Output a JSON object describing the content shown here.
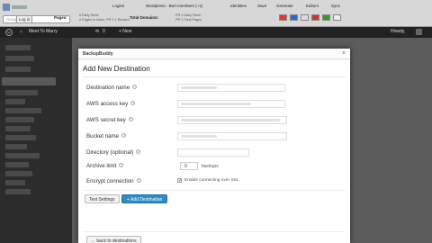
{
  "toolbar": {
    "search_placeholder": "Google",
    "login_label": "Log in",
    "pages_label": "Pages:",
    "pages_detail_1": "# Daily Rank",
    "pages_detail_2": "# Pages in Index",
    "pages_detail_3": "PR 0 1 Ranked",
    "pages_detail_4": "Rank Dom...",
    "domain_label": "Total Domains:",
    "domain_detail_1": "PR 0 Daily Rank",
    "domain_detail_2": "PR 0 Total Pages",
    "menu_1": "Logins",
    "menu_2": "Wordpress - Bert members (~1)",
    "menu_3": "Identities",
    "menu_4": "Save",
    "menu_5": "Generate",
    "menu_6": "Editors",
    "menu_7": "Sync"
  },
  "adminbar": {
    "site_name": "Meet To Marry",
    "comments_count": "0",
    "new_label": "+ New",
    "howdy": "Howdy,"
  },
  "modal": {
    "app_title": "BackupBuddy",
    "close_icon": "×",
    "heading": "Add New Destination",
    "fields": {
      "destination_name": {
        "label": "Destination name"
      },
      "access_key": {
        "label": "AWS access key"
      },
      "secret_key": {
        "label": "AWS secret key"
      },
      "bucket_name": {
        "label": "Bucket name"
      },
      "directory": {
        "label": "Directory (optional)"
      },
      "archive_limit": {
        "label": "Archive limit",
        "value": "0",
        "unit": "backups"
      },
      "encrypt": {
        "label": "Encrypt connection",
        "checkbox_label": "Enable connecting over SSL",
        "checked": true
      }
    },
    "test_button": "Test Settings",
    "add_button": "+ Add Destination",
    "back_link": "← back to destinations"
  },
  "colors": {
    "primary_button": "#2e8cc7",
    "sidebar": "#2c2c2c",
    "adminbar": "#222222"
  }
}
